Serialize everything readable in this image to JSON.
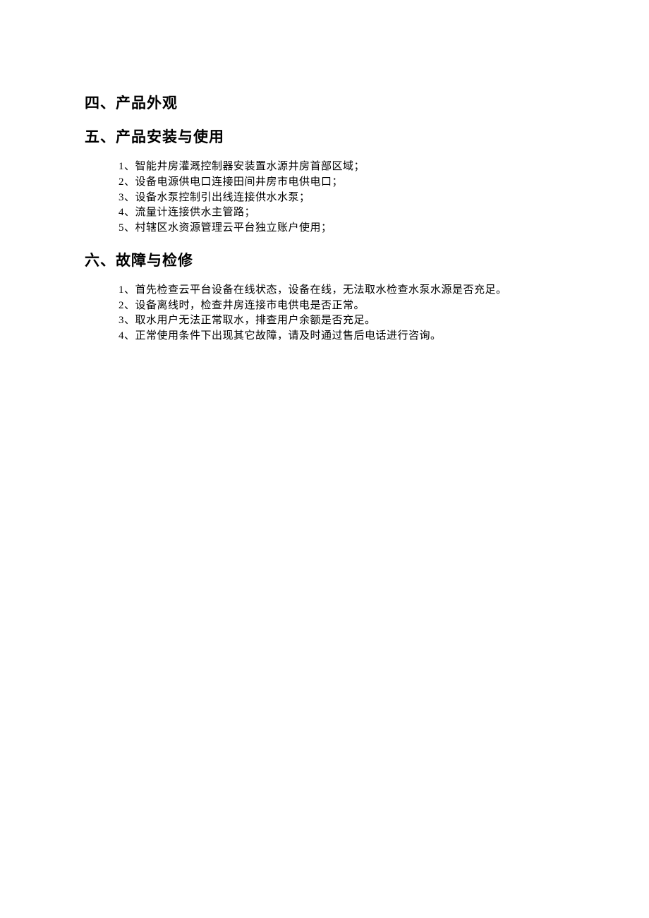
{
  "sections": {
    "s4": {
      "heading": "四、产品外观"
    },
    "s5": {
      "heading": "五、产品安装与使用",
      "items": [
        {
          "num": "1、",
          "text": "智能井房灌溉控制器安装置水源井房首部区域；"
        },
        {
          "num": "2、",
          "text": "设备电源供电口连接田间井房市电供电口；"
        },
        {
          "num": "3、",
          "text": "设备水泵控制引出线连接供水水泵；"
        },
        {
          "num": "4、",
          "text": "流量计连接供水主管路；"
        },
        {
          "num": "5、",
          "text": "村辖区水资源管理云平台独立账户使用；"
        }
      ]
    },
    "s6": {
      "heading": "六、故障与检修",
      "items": [
        {
          "num": "1、",
          "text": "首先检查云平台设备在线状态，设备在线，无法取水检查水泵水源是否充足。"
        },
        {
          "num": "2、",
          "text": "设备离线时，检查井房连接市电供电是否正常。"
        },
        {
          "num": "3、",
          "text": "取水用户无法正常取水，排查用户余额是否充足。"
        },
        {
          "num": "4、",
          "text": "正常使用条件下出现其它故障，请及时通过售后电话进行咨询。"
        }
      ]
    }
  }
}
